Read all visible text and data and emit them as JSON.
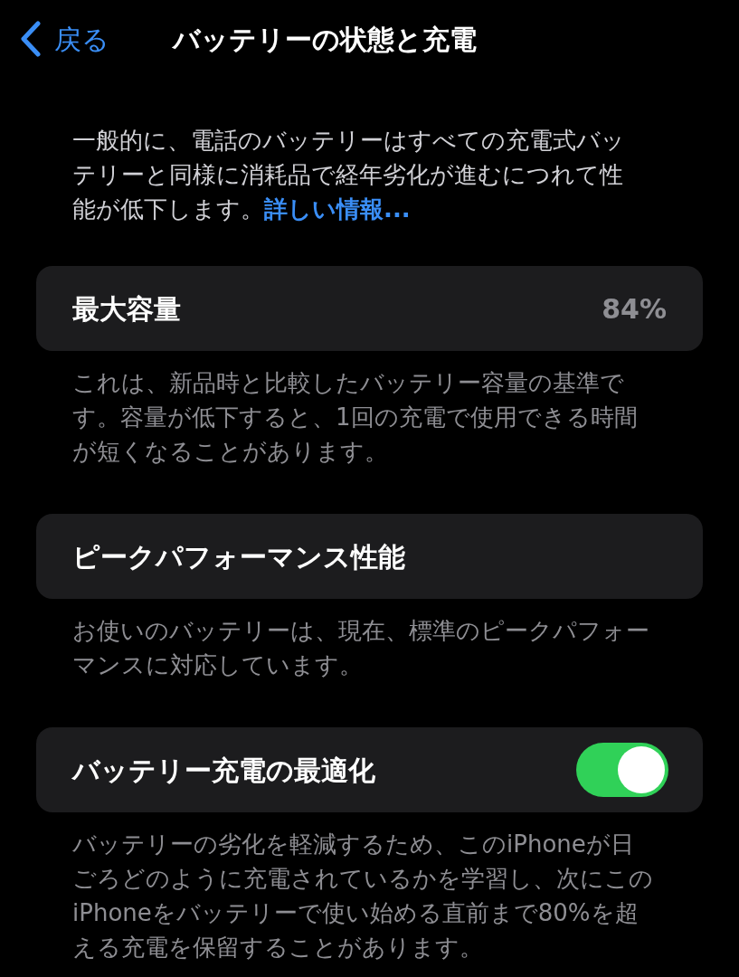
{
  "nav": {
    "back_label": "戻る",
    "title": "バッテリーの状態と充電"
  },
  "intro": {
    "text": "一般的に、電話のバッテリーはすべての充電式バッテリーと同様に消耗品で経年劣化が進むにつれて性能が低下します。",
    "link": "詳しい情報..."
  },
  "sections": [
    {
      "kind": "value",
      "label": "最大容量",
      "value": "84%",
      "footer": "これは、新品時と比較したバッテリー容量の基準です。容量が低下すると、1回の充電で使用できる時間が短くなることがあります。"
    },
    {
      "kind": "plain",
      "label": "ピークパフォーマンス性能",
      "footer": "お使いのバッテリーは、現在、標準のピークパフォーマンスに対応しています。"
    },
    {
      "kind": "toggle",
      "label": "バッテリー充電の最適化",
      "on": true,
      "footer": "バッテリーの劣化を軽減するため、このiPhoneが日ごろどのように充電されているかを学習し、次にこのiPhoneをバッテリーで使い始める直前まで80%を超える充電を保留することがあります。"
    }
  ]
}
